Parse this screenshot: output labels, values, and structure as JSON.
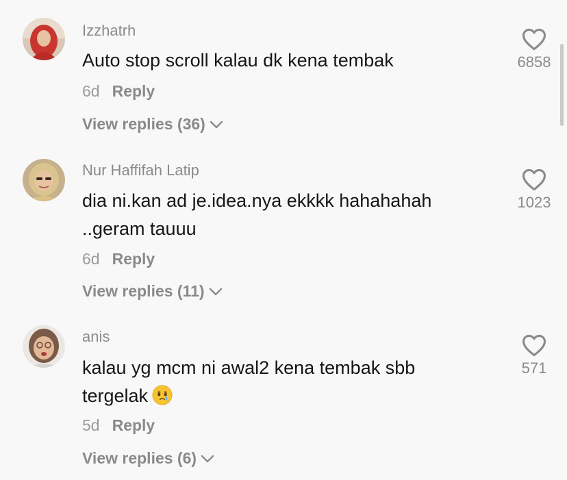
{
  "comments": [
    {
      "username": "Izzhatrh",
      "text": "Auto stop scroll kalau dk kena tembak",
      "time": "6d",
      "reply_label": "Reply",
      "view_replies": "View replies (36)",
      "likes": "6858"
    },
    {
      "username": "Nur Haffifah Latip",
      "text": "dia ni.kan ad je.idea.nya ekkkk hahahahah ..geram tauuu",
      "time": "6d",
      "reply_label": "Reply",
      "view_replies": "View replies (11)",
      "likes": "1023"
    },
    {
      "username": "anis",
      "text": "kalau yg mcm ni awal2 kena tembak sbb tergelak",
      "time": "5d",
      "reply_label": "Reply",
      "view_replies": "View replies (6)",
      "likes": "571"
    }
  ],
  "icons": {
    "like": "heart-outline-icon",
    "expand": "chevron-down-icon",
    "emoji": "face-holding-back-tears-emoji"
  },
  "colors": {
    "background": "#f8f8f8",
    "text": "#161616",
    "muted": "#8a8a8a"
  }
}
